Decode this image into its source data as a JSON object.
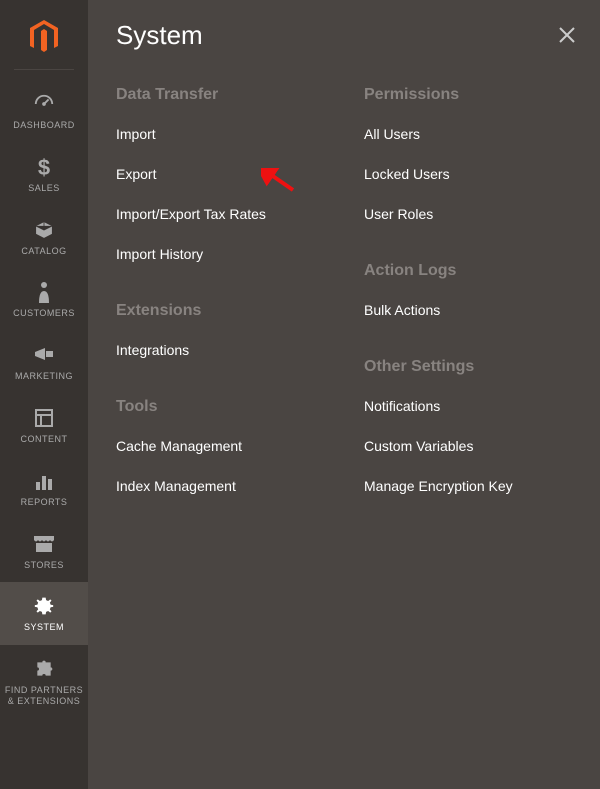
{
  "sidebar": {
    "items": [
      {
        "label": "DASHBOARD"
      },
      {
        "label": "SALES"
      },
      {
        "label": "CATALOG"
      },
      {
        "label": "CUSTOMERS"
      },
      {
        "label": "MARKETING"
      },
      {
        "label": "CONTENT"
      },
      {
        "label": "REPORTS"
      },
      {
        "label": "STORES"
      },
      {
        "label": "SYSTEM"
      },
      {
        "label": "FIND PARTNERS & EXTENSIONS"
      }
    ]
  },
  "panel": {
    "title": "System",
    "sections": {
      "data_transfer": {
        "heading": "Data Transfer",
        "items": [
          "Import",
          "Export",
          "Import/Export Tax Rates",
          "Import History"
        ]
      },
      "extensions": {
        "heading": "Extensions",
        "items": [
          "Integrations"
        ]
      },
      "tools": {
        "heading": "Tools",
        "items": [
          "Cache Management",
          "Index Management"
        ]
      },
      "permissions": {
        "heading": "Permissions",
        "items": [
          "All Users",
          "Locked Users",
          "User Roles"
        ]
      },
      "action_logs": {
        "heading": "Action Logs",
        "items": [
          "Bulk Actions"
        ]
      },
      "other_settings": {
        "heading": "Other Settings",
        "items": [
          "Notifications",
          "Custom Variables",
          "Manage Encryption Key"
        ]
      }
    }
  },
  "colors": {
    "accent": "#f26322"
  }
}
